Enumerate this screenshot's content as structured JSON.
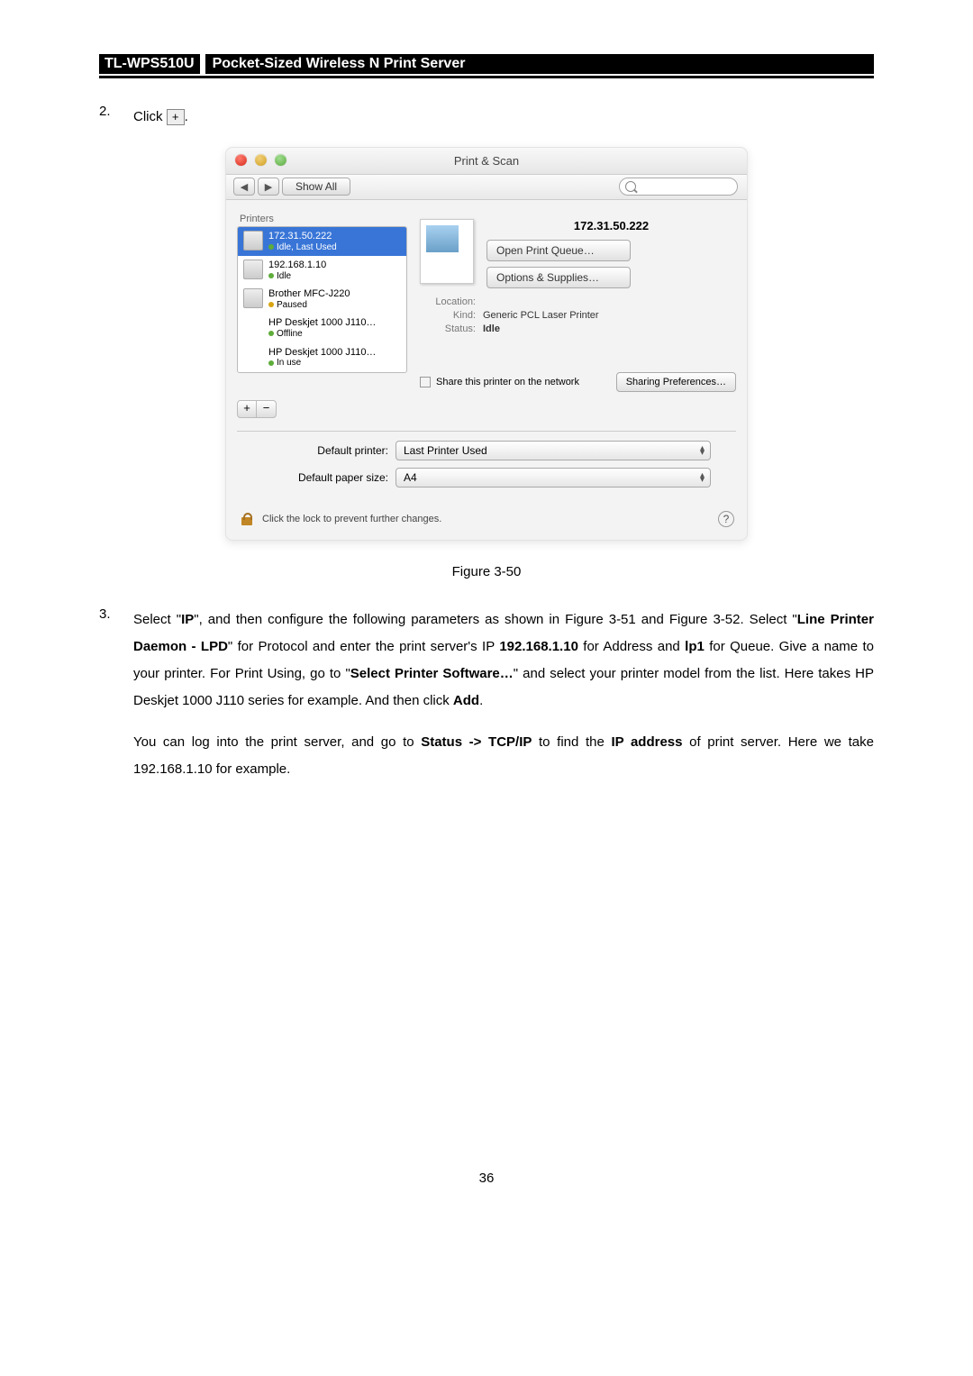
{
  "header": {
    "model": "TL-WPS510U",
    "title": "Pocket-Sized Wireless N Print Server"
  },
  "step2": {
    "num": "2.",
    "text_before": "Click ",
    "icon_glyph": "+",
    "text_after": "."
  },
  "window": {
    "title": "Print & Scan",
    "show_all": "Show All",
    "printers_label": "Printers",
    "list": [
      {
        "name": "172.31.50.222",
        "status": "Idle, Last Used",
        "selected": true,
        "dot": "green"
      },
      {
        "name": "192.168.1.10",
        "status": "Idle",
        "dot": "green"
      },
      {
        "name": "Brother MFC-J220",
        "status": "Paused",
        "dot": "yellow"
      },
      {
        "name": "HP Deskjet 1000 J110…",
        "status": "Offline",
        "dot": "green",
        "no_icon": true
      },
      {
        "name": "HP Deskjet 1000 J110…",
        "status": "In use",
        "dot": "green",
        "no_icon": true
      }
    ],
    "plus": "+",
    "minus": "−",
    "detail": {
      "title": "172.31.50.222",
      "open_queue": "Open Print Queue…",
      "options": "Options & Supplies…",
      "location_label": "Location:",
      "location_val": "",
      "kind_label": "Kind:",
      "kind_val": "Generic PCL Laser Printer",
      "status_label": "Status:",
      "status_val": "Idle",
      "share_text": "Share this printer on the network",
      "sharing_prefs": "Sharing Preferences…"
    },
    "default_printer_label": "Default printer:",
    "default_printer_value": "Last Printer Used",
    "default_paper_label": "Default paper size:",
    "default_paper_value": "A4",
    "lock_text": "Click the lock to prevent further changes.",
    "help": "?"
  },
  "caption": "Figure 3-50",
  "step3": {
    "num": "3.",
    "p1a": "Select \"",
    "p1b": "IP",
    "p1c": "\", and then configure the following parameters as shown in Figure 3-51 and Figure 3-52. Select \"",
    "p1d": "Line Printer Daemon - LPD",
    "p1e": "\" for Protocol and enter the print server's IP ",
    "p1f": "192.168.1.10",
    "p1g": " for Address and ",
    "p1h": "lp1",
    "p1i": " for Queue. Give a name to your printer. For Print Using, go to \"",
    "p1j": "Select Printer Software…",
    "p1k": "\" and select your printer model from the list. Here takes HP Deskjet 1000 J110 series for example. And then click ",
    "p1l": "Add",
    "p1m": ".",
    "p2a": "You can log into the print server, and go to ",
    "p2b": "Status -> TCP/IP",
    "p2c": " to find the ",
    "p2d": "IP address",
    "p2e": " of print server. Here we take 192.168.1.10 for example."
  },
  "page_num": "36"
}
